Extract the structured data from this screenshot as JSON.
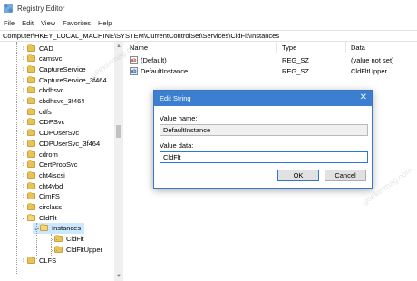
{
  "window": {
    "title": "Registry Editor"
  },
  "menu": [
    "File",
    "Edit",
    "View",
    "Favorites",
    "Help"
  ],
  "address": "Computer\\HKEY_LOCAL_MACHINE\\SYSTEM\\CurrentControlSet\\Services\\CldFlt\\Instances",
  "tree": [
    {
      "label": "CAD",
      "chevron": "›",
      "indent": 0
    },
    {
      "label": "camsvc",
      "chevron": "›",
      "indent": 0
    },
    {
      "label": "CaptureService",
      "chevron": "›",
      "indent": 0
    },
    {
      "label": "CaptureService_3f464",
      "chevron": "›",
      "indent": 0
    },
    {
      "label": "cbdhsvc",
      "chevron": "›",
      "indent": 0
    },
    {
      "label": "cbdhsvc_3f464",
      "chevron": "›",
      "indent": 0
    },
    {
      "label": "cdfs",
      "chevron": "",
      "indent": 0
    },
    {
      "label": "CDPSvc",
      "chevron": "›",
      "indent": 0
    },
    {
      "label": "CDPUserSvc",
      "chevron": "›",
      "indent": 0
    },
    {
      "label": "CDPUserSvc_3f464",
      "chevron": "›",
      "indent": 0
    },
    {
      "label": "cdrom",
      "chevron": "›",
      "indent": 0
    },
    {
      "label": "CertPropSvc",
      "chevron": "›",
      "indent": 0
    },
    {
      "label": "cht4iscsi",
      "chevron": "›",
      "indent": 0
    },
    {
      "label": "cht4vbd",
      "chevron": "›",
      "indent": 0
    },
    {
      "label": "CimFS",
      "chevron": "›",
      "indent": 0
    },
    {
      "label": "circlass",
      "chevron": "›",
      "indent": 0
    },
    {
      "label": "CldFlt",
      "chevron": "⌄",
      "indent": 0
    },
    {
      "label": "Instances",
      "chevron": "⌄",
      "indent": 1,
      "selected": true
    },
    {
      "label": "CldFlt",
      "chevron": "",
      "indent": 2
    },
    {
      "label": "CldFltUpper",
      "chevron": "",
      "indent": 2
    },
    {
      "label": "CLFS",
      "chevron": "›",
      "indent": 0
    }
  ],
  "list": {
    "headers": {
      "name": "Name",
      "type": "Type",
      "data": "Data"
    },
    "rows": [
      {
        "icon": "ab",
        "name": "(Default)",
        "type": "REG_SZ",
        "data": "(value not set)"
      },
      {
        "icon": "ab",
        "name": "DefaultInstance",
        "type": "REG_SZ",
        "data": "CldFltUpper"
      }
    ]
  },
  "dialog": {
    "title": "Edit String",
    "value_name_label": "Value name:",
    "value_name": "DefaultInstance",
    "value_data_label": "Value data:",
    "value_data": "CldFlt",
    "ok": "OK",
    "cancel": "Cancel"
  },
  "watermark": "geekermag.com"
}
